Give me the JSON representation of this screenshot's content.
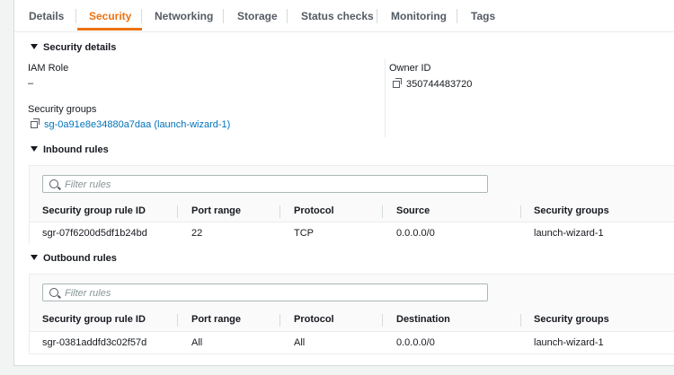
{
  "tabs": [
    "Details",
    "Security",
    "Networking",
    "Storage",
    "Status checks",
    "Monitoring",
    "Tags"
  ],
  "security_details": {
    "title": "Security details",
    "iam_role_label": "IAM Role",
    "iam_role_value": "–",
    "owner_id_label": "Owner ID",
    "owner_id_value": "350744483720",
    "security_groups_label": "Security groups",
    "security_groups_value": "sg-0a91e8e34880a7daa (launch-wizard-1)"
  },
  "inbound": {
    "title": "Inbound rules",
    "filter_placeholder": "Filter rules",
    "columns": [
      "Security group rule ID",
      "Port range",
      "Protocol",
      "Source",
      "Security groups"
    ],
    "rows": [
      [
        "sgr-07f6200d5df1b24bd",
        "22",
        "TCP",
        "0.0.0.0/0",
        "launch-wizard-1"
      ]
    ]
  },
  "outbound": {
    "title": "Outbound rules",
    "filter_placeholder": "Filter rules",
    "columns": [
      "Security group rule ID",
      "Port range",
      "Protocol",
      "Destination",
      "Security groups"
    ],
    "rows": [
      [
        "sgr-0381addfd3c02f57d",
        "All",
        "All",
        "0.0.0.0/0",
        "launch-wizard-1"
      ]
    ]
  },
  "colors": {
    "accent": "#ec7211",
    "link": "#0073bb"
  }
}
